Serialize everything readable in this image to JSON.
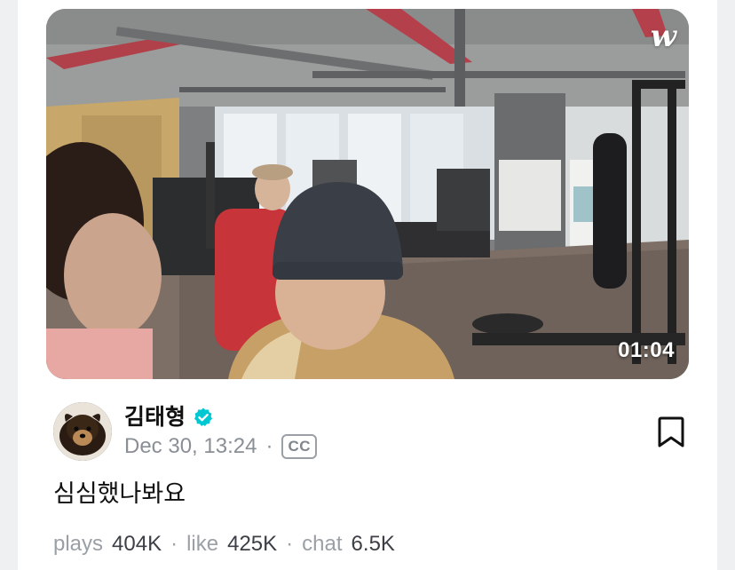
{
  "video": {
    "duration": "01:04",
    "logo_text": "w",
    "thumbnail": "gym interior with four people, one in red jacket and cap, one in grey beanie"
  },
  "author": {
    "name": "김태형",
    "verified": true,
    "verified_icon": "verified-check-icon",
    "avatar": "dog-avatar"
  },
  "post": {
    "date": "Dec 30, 13:24",
    "separator": "·",
    "cc_label": "CC",
    "caption": "심심했나봐요"
  },
  "stats": {
    "plays_label": "plays",
    "plays_value": "404K",
    "like_label": "like",
    "like_value": "425K",
    "chat_label": "chat",
    "chat_value": "6.5K",
    "separator": "·"
  },
  "colors": {
    "verified": "#00c8d2",
    "meta_text": "#8a8f96",
    "stat_value": "#3c4046"
  }
}
